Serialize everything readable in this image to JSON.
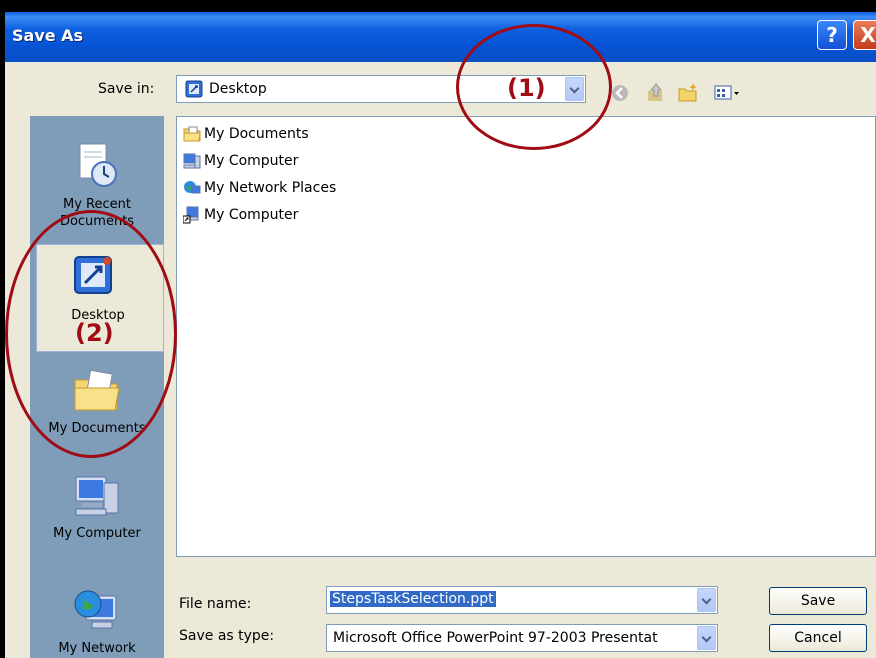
{
  "dialog": {
    "title": "Save As",
    "help_button": "?",
    "close_button": "X"
  },
  "save_in": {
    "label": "Save in:",
    "value": "Desktop"
  },
  "toolbar": {
    "icons": [
      "back-icon",
      "up-folder-icon",
      "new-folder-icon",
      "views-menu-icon"
    ]
  },
  "places_bar": {
    "items": [
      {
        "label": "My Recent\nDocuments",
        "line1": "My Recent",
        "line2": "Documents",
        "icon": "recent-documents-icon"
      },
      {
        "label": "Desktop",
        "icon": "desktop-icon",
        "selected": true
      },
      {
        "label": "My Documents",
        "icon": "my-documents-folder-icon"
      },
      {
        "label": "My Computer",
        "icon": "my-computer-icon"
      },
      {
        "label": "My Network",
        "icon": "my-network-icon"
      }
    ]
  },
  "file_list": {
    "items": [
      {
        "name": "My Documents",
        "icon": "my-documents-folder-icon"
      },
      {
        "name": "My Computer",
        "icon": "my-computer-icon"
      },
      {
        "name": "My Network Places",
        "icon": "network-places-icon"
      },
      {
        "name": "My Computer",
        "icon": "my-computer-shortcut-icon"
      }
    ]
  },
  "file_name": {
    "label": "File name:",
    "value": "StepsTaskSelection.ppt"
  },
  "save_as_type": {
    "label": "Save as type:",
    "value": "Microsoft Office PowerPoint 97-2003 Presentat"
  },
  "buttons": {
    "save": "Save",
    "cancel": "Cancel"
  },
  "annotations": {
    "label_1": "(1)",
    "label_2": "(2)",
    "color": "#a00b14"
  },
  "colors": {
    "titlebar": "#0553d3",
    "dialog_bg": "#ece9d8",
    "places_bg": "#7f9db9",
    "filename_selection": "#316ac5"
  }
}
